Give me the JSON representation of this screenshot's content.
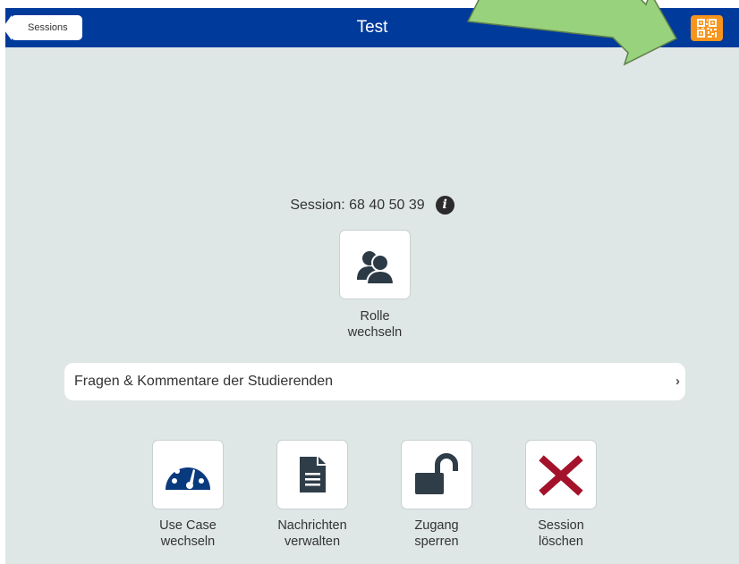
{
  "navbar": {
    "back_label": "Sessions",
    "title": "Test",
    "qr_icon": "qr-code-icon",
    "accent": "#003a9b",
    "qr_color": "#f7941d"
  },
  "session": {
    "label": "Session: 68 40 50 39",
    "info_icon_glyph": "i"
  },
  "role_tile": {
    "icon": "users-icon",
    "caption_line1": "Rolle",
    "caption_line2": "wechseln"
  },
  "comments": {
    "label": "Fragen & Kommentare der Studierenden",
    "chevron": "›"
  },
  "actions": [
    {
      "icon": "dashboard-gauge-icon",
      "line1": "Use Case",
      "line2": "wechseln"
    },
    {
      "icon": "document-icon",
      "line1": "Nachrichten",
      "line2": "verwalten"
    },
    {
      "icon": "unlock-icon",
      "line1": "Zugang",
      "line2": "sperren"
    },
    {
      "icon": "delete-x-icon",
      "line1": "Session",
      "line2": "löschen"
    }
  ],
  "colors": {
    "background": "#dfe6e6",
    "icon_blue": "#0a3a7e",
    "icon_dark": "#2f3d49",
    "delete_red": "#a3122a",
    "arrow_green": "#98d27c"
  }
}
